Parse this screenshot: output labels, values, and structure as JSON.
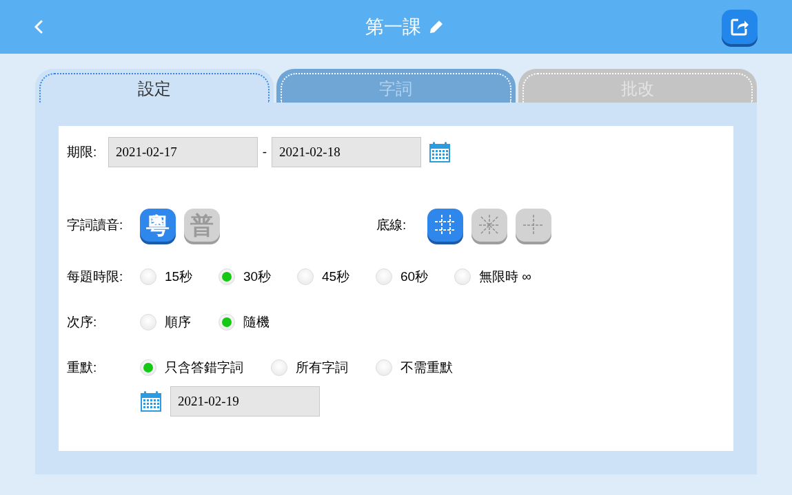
{
  "header": {
    "title": "第一課"
  },
  "tabs": [
    {
      "label": "設定",
      "selected": true,
      "disabled": false
    },
    {
      "label": "字詞",
      "selected": false,
      "disabled": false
    },
    {
      "label": "批改",
      "selected": false,
      "disabled": true
    }
  ],
  "period": {
    "label": "期限:",
    "from": "2021-02-17",
    "separator": "-",
    "to": "2021-02-18"
  },
  "pronunciation": {
    "label": "字詞讀音:",
    "options": [
      {
        "label": "粵",
        "selected": true
      },
      {
        "label": "普",
        "selected": false
      }
    ]
  },
  "baseline": {
    "label": "底線:",
    "options": [
      {
        "kind": "grid",
        "selected": true
      },
      {
        "kind": "star",
        "selected": false
      },
      {
        "kind": "cross",
        "selected": false
      }
    ]
  },
  "time_limit": {
    "label": "每題時限:",
    "options": [
      {
        "label": "15秒",
        "selected": false
      },
      {
        "label": "30秒",
        "selected": true
      },
      {
        "label": "45秒",
        "selected": false
      },
      {
        "label": "60秒",
        "selected": false
      },
      {
        "label": "無限時 ∞",
        "selected": false
      }
    ]
  },
  "order": {
    "label": "次序:",
    "options": [
      {
        "label": "順序",
        "selected": false
      },
      {
        "label": "隨機",
        "selected": true
      }
    ]
  },
  "rewrite": {
    "label": "重默:",
    "options": [
      {
        "label": "只含答錯字詞",
        "selected": true
      },
      {
        "label": "所有字詞",
        "selected": false
      },
      {
        "label": "不需重默",
        "selected": false
      }
    ],
    "date": "2021-02-19"
  }
}
